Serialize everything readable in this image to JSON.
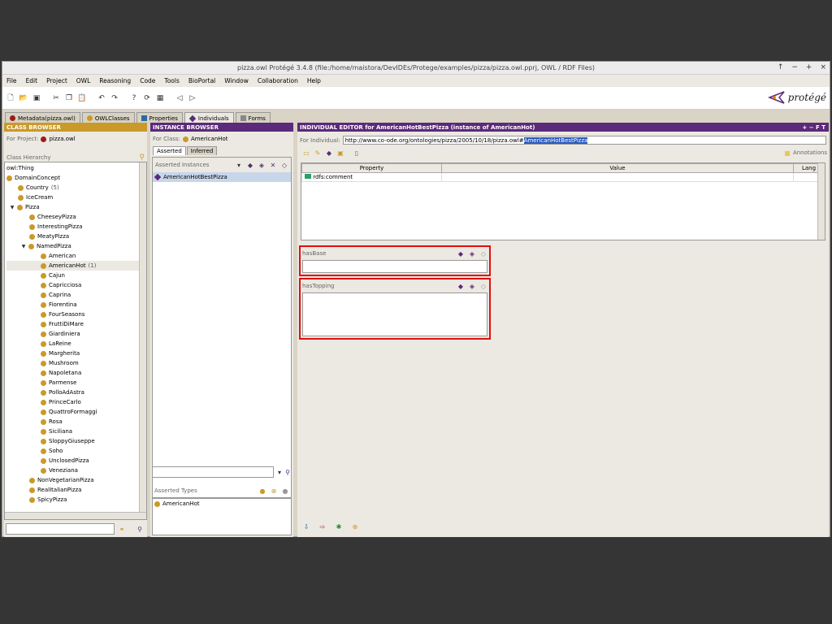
{
  "window": {
    "title": "pizza.owl  Protégé 3.4.8    (file:/home/maistora/DevIDEs/Protege/examples/pizza/pizza.owl.pprj, OWL / RDF Files)",
    "controls": [
      "↑",
      "−",
      "+",
      "×"
    ]
  },
  "menu": [
    "File",
    "Edit",
    "Project",
    "OWL",
    "Reasoning",
    "Code",
    "Tools",
    "BioPortal",
    "Window",
    "Collaboration",
    "Help"
  ],
  "logo": "protégé",
  "tabs": [
    {
      "label": "Metadata(pizza.owl)"
    },
    {
      "label": "OWLClasses"
    },
    {
      "label": "Properties"
    },
    {
      "label": "Individuals"
    },
    {
      "label": "Forms"
    }
  ],
  "class_browser": {
    "header": "CLASS BROWSER",
    "for_project_label": "For Project:",
    "project": "pizza.owl",
    "hierarchy_label": "Class Hierarchy",
    "root": "owl:Thing",
    "items": [
      {
        "label": "DomainConcept",
        "count": ""
      },
      {
        "label": "Country",
        "count": "(5)"
      },
      {
        "label": "IceCream",
        "count": ""
      },
      {
        "label": "Pizza",
        "count": ""
      },
      {
        "label": "CheeseyPizza",
        "count": ""
      },
      {
        "label": "InterestingPizza",
        "count": ""
      },
      {
        "label": "MeatyPizza",
        "count": ""
      },
      {
        "label": "NamedPizza",
        "count": ""
      },
      {
        "label": "American",
        "count": ""
      },
      {
        "label": "AmericanHot",
        "count": "(1)"
      },
      {
        "label": "Cajun",
        "count": ""
      },
      {
        "label": "Capricciosa",
        "count": ""
      },
      {
        "label": "Caprina",
        "count": ""
      },
      {
        "label": "Fiorentina",
        "count": ""
      },
      {
        "label": "FourSeasons",
        "count": ""
      },
      {
        "label": "FruttiDiMare",
        "count": ""
      },
      {
        "label": "Giardiniera",
        "count": ""
      },
      {
        "label": "LaReine",
        "count": ""
      },
      {
        "label": "Margherita",
        "count": ""
      },
      {
        "label": "Mushroom",
        "count": ""
      },
      {
        "label": "Napoletana",
        "count": ""
      },
      {
        "label": "Parmense",
        "count": ""
      },
      {
        "label": "PolloAdAstra",
        "count": ""
      },
      {
        "label": "PrinceCarlo",
        "count": ""
      },
      {
        "label": "QuattroFormaggi",
        "count": ""
      },
      {
        "label": "Rosa",
        "count": ""
      },
      {
        "label": "Siciliana",
        "count": ""
      },
      {
        "label": "SloppyGiuseppe",
        "count": ""
      },
      {
        "label": "Soho",
        "count": ""
      },
      {
        "label": "UnclosedPizza",
        "count": ""
      },
      {
        "label": "Veneziana",
        "count": ""
      },
      {
        "label": "NonVegetarianPizza",
        "count": ""
      },
      {
        "label": "RealItalianPizza",
        "count": ""
      },
      {
        "label": "SpicyPizza",
        "count": ""
      }
    ]
  },
  "instance_browser": {
    "header": "INSTANCE BROWSER",
    "for_class_label": "For Class:",
    "class": "AmericanHot",
    "subtabs": [
      "Asserted",
      "Inferred"
    ],
    "asserted_label": "Asserted Instances",
    "instances": [
      "AmericanHotBestPizza"
    ],
    "types_label": "Asserted Types",
    "types": [
      "AmericanHot"
    ]
  },
  "individual_editor": {
    "header": "INDIVIDUAL EDITOR for AmericanHotBestPizza   (instance of AmericanHot)",
    "header_controls": "+ − F T",
    "for_individual_label": "For Individual:",
    "uri_prefix": "http://www.co-ode.org/ontologies/pizza/2005/10/18/pizza.owl#",
    "uri_selected": "AmericanHotBestPizza",
    "annotations_label": "Annotations",
    "columns": [
      "Property",
      "Value",
      "Lang"
    ],
    "rows": [
      {
        "property": "rdfs:comment",
        "value": "",
        "lang": ""
      }
    ],
    "has_base_label": "hasBase",
    "has_topping_label": "hasTopping"
  }
}
